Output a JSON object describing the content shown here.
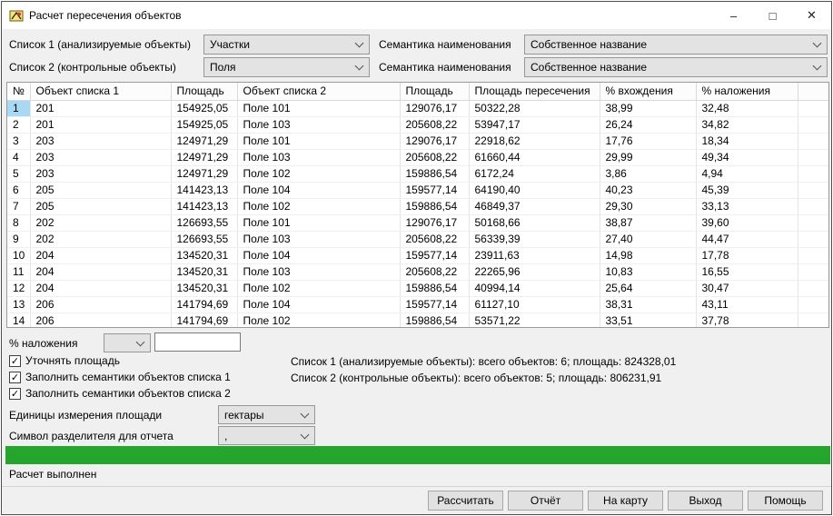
{
  "window": {
    "title": "Расчет пересечения объектов",
    "controls": [
      {
        "name": "minimize-icon",
        "glyph": "–"
      },
      {
        "name": "maximize-icon",
        "glyph": "□"
      },
      {
        "name": "close-icon",
        "glyph": "✕"
      }
    ]
  },
  "selectors": {
    "list1_label": "Список 1 (анализируемые объекты)",
    "list1_value": "Участки",
    "list2_label": "Список 2 (контрольные объекты)",
    "list2_value": "Поля",
    "semantic1_label": "Семантика наименования",
    "semantic1_value": "Собственное название",
    "semantic2_label": "Семантика наименования",
    "semantic2_value": "Собственное название"
  },
  "table": {
    "headers": [
      "№",
      "Объект списка 1",
      "Площадь",
      "Объект списка 2",
      "Площадь",
      "Площадь пересечения",
      "% вхождения",
      "% наложения"
    ],
    "rows": [
      [
        "1",
        "201",
        "154925,05",
        "Поле 101",
        "129076,17",
        "50322,28",
        "38,99",
        "32,48"
      ],
      [
        "2",
        "201",
        "154925,05",
        "Поле 103",
        "205608,22",
        "53947,17",
        "26,24",
        "34,82"
      ],
      [
        "3",
        "203",
        "124971,29",
        "Поле 101",
        "129076,17",
        "22918,62",
        "17,76",
        "18,34"
      ],
      [
        "4",
        "203",
        "124971,29",
        "Поле 103",
        "205608,22",
        "61660,44",
        "29,99",
        "49,34"
      ],
      [
        "5",
        "203",
        "124971,29",
        "Поле 102",
        "159886,54",
        "6172,24",
        "3,86",
        "4,94"
      ],
      [
        "6",
        "205",
        "141423,13",
        "Поле 104",
        "159577,14",
        "64190,40",
        "40,23",
        "45,39"
      ],
      [
        "7",
        "205",
        "141423,13",
        "Поле 102",
        "159886,54",
        "46849,37",
        "29,30",
        "33,13"
      ],
      [
        "8",
        "202",
        "126693,55",
        "Поле 101",
        "129076,17",
        "50168,66",
        "38,87",
        "39,60"
      ],
      [
        "9",
        "202",
        "126693,55",
        "Поле 103",
        "205608,22",
        "56339,39",
        "27,40",
        "44,47"
      ],
      [
        "10",
        "204",
        "134520,31",
        "Поле 104",
        "159577,14",
        "23911,63",
        "14,98",
        "17,78"
      ],
      [
        "11",
        "204",
        "134520,31",
        "Поле 103",
        "205608,22",
        "22265,96",
        "10,83",
        "16,55"
      ],
      [
        "12",
        "204",
        "134520,31",
        "Поле 102",
        "159886,54",
        "40994,14",
        "25,64",
        "30,47"
      ],
      [
        "13",
        "206",
        "141794,69",
        "Поле 104",
        "159577,14",
        "61127,10",
        "38,31",
        "43,11"
      ],
      [
        "14",
        "206",
        "141794,69",
        "Поле 102",
        "159886,54",
        "53571,22",
        "33,51",
        "37,78"
      ]
    ],
    "selected_cell": {
      "row": 0,
      "col": 0
    },
    "selection_color": "#a7d9f5"
  },
  "filter": {
    "label": "% наложения",
    "operator_value": "",
    "value": ""
  },
  "options": {
    "checkboxes": [
      {
        "label": "Уточнять площадь",
        "checked": true,
        "check_glyph": "✓"
      },
      {
        "label": "Заполнить семантики объектов списка 1",
        "checked": true,
        "check_glyph": "✓"
      },
      {
        "label": "Заполнить семантики объектов списка 2",
        "checked": true,
        "check_glyph": "✓"
      }
    ],
    "units_label": "Единицы измерения площади",
    "units_value": "гектары",
    "separator_label": "Символ разделителя для отчета",
    "separator_value": ","
  },
  "summary": {
    "line1": "Список 1 (анализируемые объекты): всего объектов: 6; площадь: 824328,01",
    "line2": "Список 2 (контрольные объекты): всего объектов: 5; площадь: 806231,91"
  },
  "progress": {
    "percent": 100,
    "color": "#25a52d"
  },
  "status": "Расчет выполнен",
  "footer": {
    "buttons": [
      "Рассчитать",
      "Отчёт",
      "На карту",
      "Выход",
      "Помощь"
    ]
  }
}
